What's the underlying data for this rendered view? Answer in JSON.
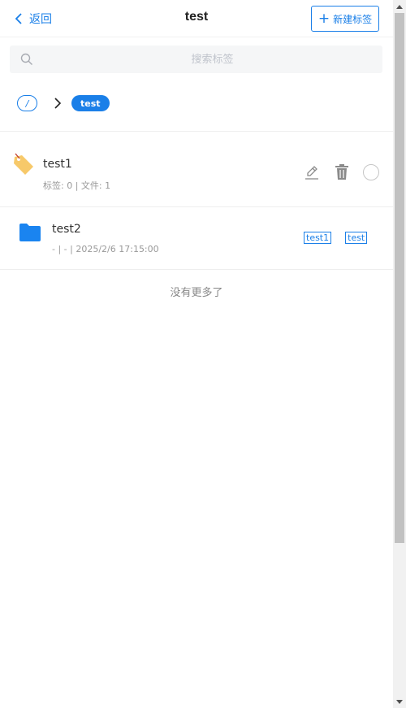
{
  "header": {
    "back_label": "返回",
    "title": "test",
    "new_tag_label": "新建标签"
  },
  "search": {
    "placeholder": "搜索标签",
    "value": ""
  },
  "breadcrumb": {
    "root_label": "/",
    "current_label": "test"
  },
  "items": [
    {
      "type": "tag",
      "name": "test1",
      "meta": "标签: 0 | 文件: 1",
      "icon": "tag-icon"
    },
    {
      "type": "folder",
      "name": "test2",
      "meta": "- | - | 2025/2/6 17:15:00",
      "icon": "folder-icon",
      "tags": [
        "test1",
        "test"
      ]
    }
  ],
  "footer": {
    "no_more_label": "没有更多了"
  },
  "colors": {
    "accent": "#1a7fe8",
    "tag_icon": "#f7c96a",
    "muted_text": "#999999"
  }
}
